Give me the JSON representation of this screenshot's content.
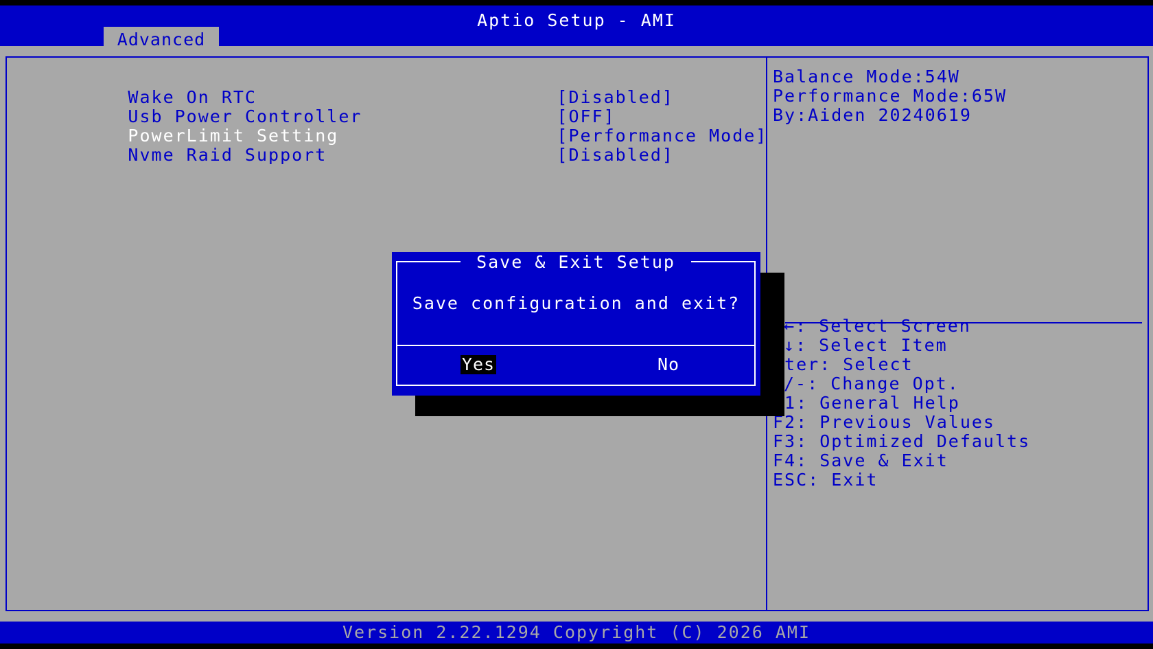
{
  "header": {
    "title": "Aptio Setup - AMI",
    "active_tab": "Advanced"
  },
  "settings": [
    {
      "label": "Wake On RTC",
      "value": "[Disabled]",
      "selected": false
    },
    {
      "label": "Usb Power Controller",
      "value": "[OFF]",
      "selected": false
    },
    {
      "label": "PowerLimit Setting",
      "value": "[Performance Mode]",
      "selected": true
    },
    {
      "label": "Nvme Raid Support",
      "value": "[Disabled]",
      "selected": false
    }
  ],
  "help_info": [
    "Balance Mode:54W",
    "Performance Mode:65W",
    "By:Aiden 20240619"
  ],
  "key_help": [
    "←: Select Screen",
    "↓: Select Item",
    "nter: Select",
    "/-: Change Opt.",
    "F1: General Help",
    "F2: Previous Values",
    "F3: Optimized Defaults",
    "F4: Save & Exit",
    "ESC: Exit"
  ],
  "dialog": {
    "title": "Save & Exit Setup",
    "message": "Save configuration and exit?",
    "yes_label": "Yes",
    "no_label": "No"
  },
  "footer": {
    "version": "Version 2.22.1294 Copyright (C) 2026 AMI"
  },
  "colors": {
    "bios_blue": "#0000c8",
    "bios_grey": "#a8a8a8",
    "highlight_bg": "#000000",
    "text_white": "#ffffff"
  }
}
